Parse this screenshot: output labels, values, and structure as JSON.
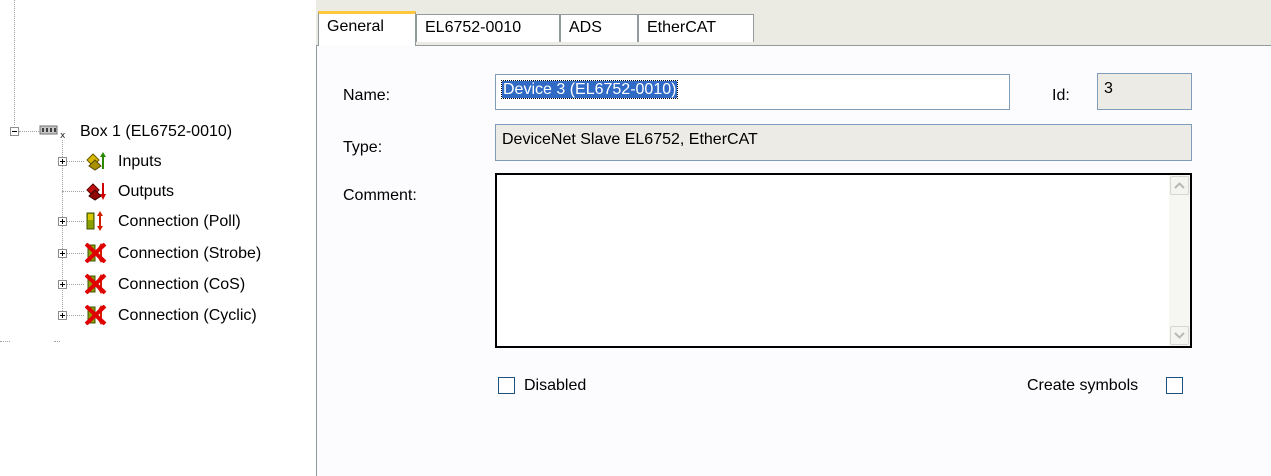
{
  "tree": {
    "items": [
      {
        "label": "Box 1 (EL6752-0010)",
        "icon": "box-device-icon",
        "expander": "minus"
      },
      {
        "label": "Inputs",
        "icon": "inputs-icon",
        "expander": "plus"
      },
      {
        "label": "Outputs",
        "icon": "outputs-icon",
        "expander": "none"
      },
      {
        "label": "Connection (Poll)",
        "icon": "connection-poll-icon",
        "expander": "plus"
      },
      {
        "label": "Connection (Strobe)",
        "icon": "connection-disabled-icon",
        "expander": "plus"
      },
      {
        "label": "Connection (CoS)",
        "icon": "connection-disabled-icon",
        "expander": "plus"
      },
      {
        "label": "Connection (Cyclic)",
        "icon": "connection-disabled-icon",
        "expander": "plus"
      }
    ]
  },
  "tabs": [
    {
      "label": "General",
      "active": true
    },
    {
      "label": "EL6752-0010",
      "active": false
    },
    {
      "label": "ADS",
      "active": false
    },
    {
      "label": "EtherCAT",
      "active": false
    }
  ],
  "general": {
    "name_label": "Name:",
    "name_value": "Device 3 (EL6752-0010)",
    "id_label": "Id:",
    "id_value": "3",
    "type_label": "Type:",
    "type_value": "DeviceNet Slave EL6752, EtherCAT",
    "comment_label": "Comment:",
    "comment_value": "",
    "disabled_label": "Disabled",
    "disabled_checked": false,
    "create_symbols_label": "Create symbols",
    "create_symbols_checked": false
  },
  "colors": {
    "selection": "#316ac5",
    "tab_highlight": "#ffc83c",
    "field_border": "#7f9db9",
    "checkbox_border": "#1c5180"
  }
}
